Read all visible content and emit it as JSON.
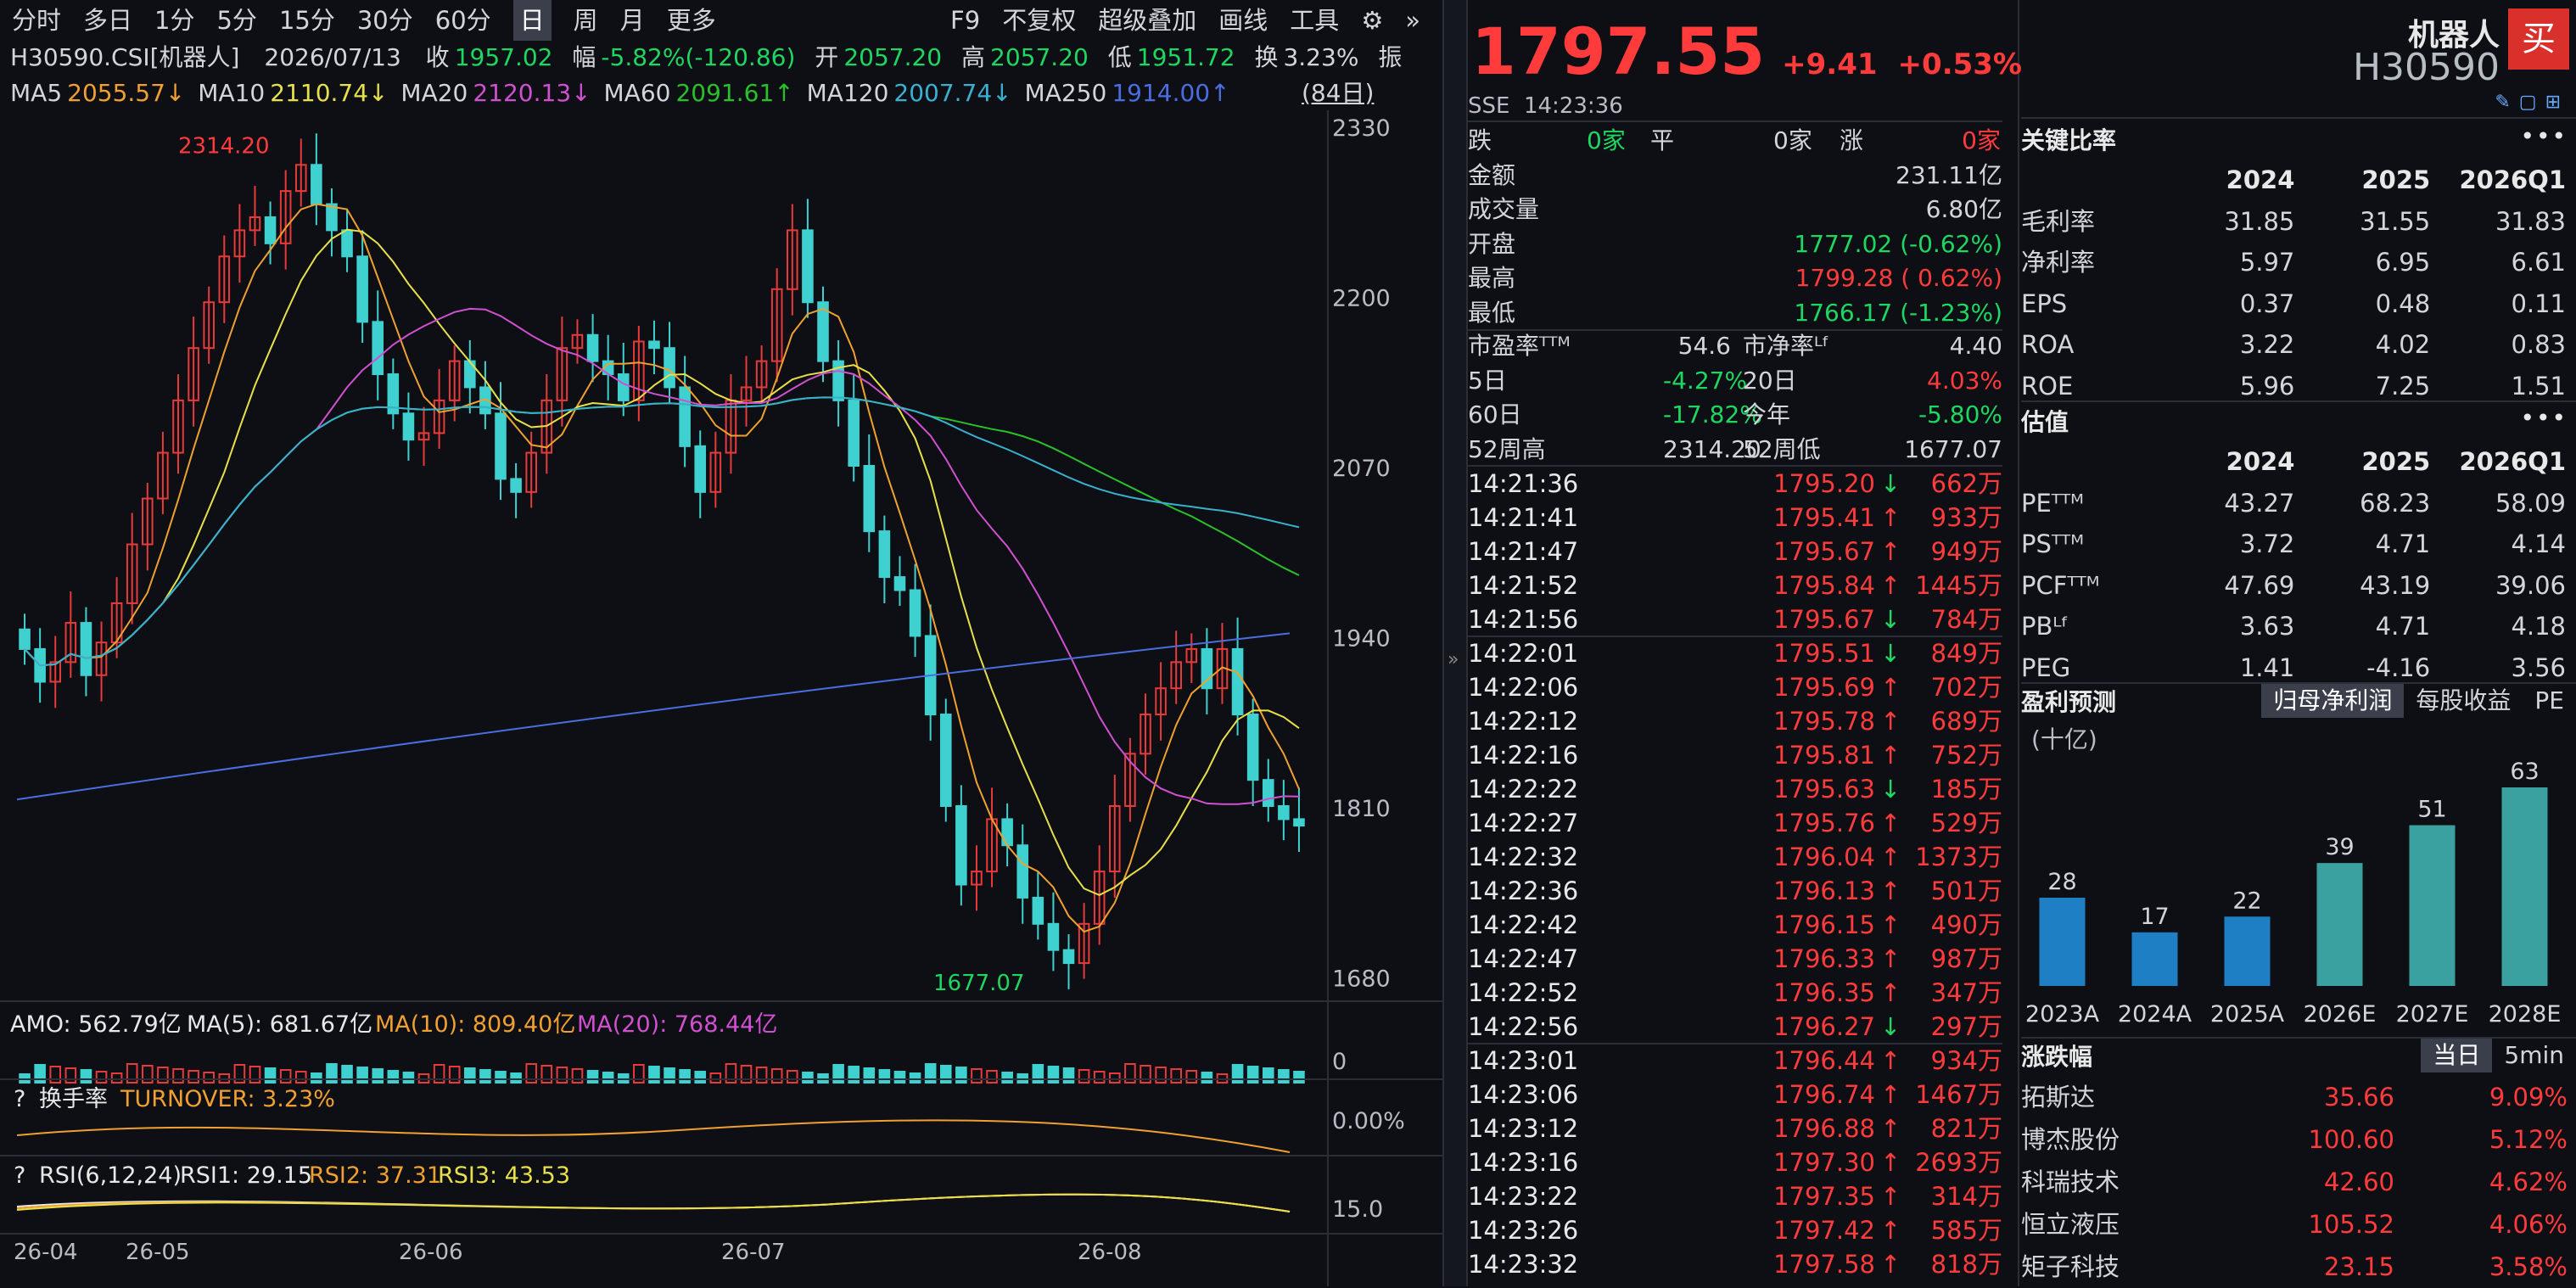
{
  "toolbar": {
    "periods": [
      "分时",
      "多日",
      "1分",
      "5分",
      "15分",
      "30分",
      "60分",
      "日",
      "周",
      "月",
      "更多"
    ],
    "active_period": "日",
    "right": [
      "F9",
      "不复权",
      "超级叠加",
      "画线",
      "工具"
    ]
  },
  "info": {
    "code": "H30590.CSI[机器人]",
    "date": "2026/07/13",
    "close_label": "收",
    "close": "1957.02",
    "chg_label": "幅",
    "chg": "-5.82%(-120.86)",
    "open_label": "开",
    "open": "2057.20",
    "high_label": "高",
    "high": "2057.20",
    "low_label": "低",
    "low": "1951.72",
    "turnover_label": "换",
    "turnover": "3.23%",
    "amp_label": "振"
  },
  "ma": {
    "ma5": "MA5",
    "ma5_val": "2055.57↓",
    "ma10": "MA10",
    "ma10_val": "2110.74↓",
    "ma20": "MA20",
    "ma20_val": "2120.13↓",
    "ma60": "MA60",
    "ma60_val": "2091.61↑",
    "ma120": "MA120",
    "ma120_val": "2007.74↓",
    "ma250": "MA250",
    "ma250_val": "1914.00↑",
    "days": "(84日)"
  },
  "chart_data": {
    "type": "candlestick",
    "y_axis_ticks": [
      "2330",
      "2200",
      "2070",
      "1940",
      "1810",
      "1680"
    ],
    "x_axis_ticks": [
      "26-04",
      "26-05",
      "26-06",
      "26-07",
      "26-08"
    ],
    "annotations": {
      "high": "2314.20",
      "low": "1677.07"
    },
    "volume": {
      "label": "AMO: 562.79亿",
      "ma5": "MA(5): 681.67亿",
      "ma10": "MA(10): 809.40亿",
      "ma20": "MA(20): 768.44亿",
      "axis": "0"
    },
    "turnover": {
      "q": "?",
      "label": "换手率",
      "value": "TURNOVER: 3.23%",
      "axis": "0.00%"
    },
    "rsi": {
      "q": "?",
      "label": "RSI(6,12,24)",
      "rsi1": "RSI1: 29.15",
      "rsi2": "RSI2: 37.31",
      "rsi3": "RSI3: 43.53",
      "axis": "15.0"
    }
  },
  "quote": {
    "price": "1797.55",
    "change": "+9.41",
    "change_pct": "+0.53%",
    "exchange": "SSE",
    "time": "14:23:36",
    "breadth": {
      "down_label": "跌",
      "down": "0家",
      "flat_label": "平",
      "flat": "0家",
      "up_label": "涨",
      "up": "0家"
    },
    "amount_label": "金额",
    "amount": "231.11亿",
    "volume_label": "成交量",
    "volume": "6.80亿",
    "open_label": "开盘",
    "open": "1777.02 (-0.62%)",
    "high_label": "最高",
    "high": "1799.28 ( 0.62%)",
    "low_label": "最低",
    "low": "1766.17 (-1.23%)",
    "pe_label": "市盈率ᵀᵀᴹ",
    "pe": "54.6",
    "pb_label": "市净率ᴸᶠ",
    "pb": "4.40",
    "d5_label": "5日",
    "d5": "-4.27%",
    "d20_label": "20日",
    "d20": "4.03%",
    "d60_label": "60日",
    "d60": "-17.82%",
    "ytd_label": "今年",
    "ytd": "-5.80%",
    "w52h_label": "52周高",
    "w52h": "2314.20",
    "w52l_label": "52周低",
    "w52l": "1677.07"
  },
  "ticks": [
    {
      "t": "14:21:36",
      "p": "1795.20",
      "d": "down",
      "v": "662万"
    },
    {
      "t": "14:21:41",
      "p": "1795.41",
      "d": "up",
      "v": "933万"
    },
    {
      "t": "14:21:47",
      "p": "1795.67",
      "d": "up",
      "v": "949万"
    },
    {
      "t": "14:21:52",
      "p": "1795.84",
      "d": "up",
      "v": "1445万"
    },
    {
      "t": "14:21:56",
      "p": "1795.67",
      "d": "down",
      "v": "784万"
    },
    {
      "t": "14:22:01",
      "p": "1795.51",
      "d": "down",
      "v": "849万"
    },
    {
      "t": "14:22:06",
      "p": "1795.69",
      "d": "up",
      "v": "702万"
    },
    {
      "t": "14:22:12",
      "p": "1795.78",
      "d": "up",
      "v": "689万"
    },
    {
      "t": "14:22:16",
      "p": "1795.81",
      "d": "up",
      "v": "752万"
    },
    {
      "t": "14:22:22",
      "p": "1795.63",
      "d": "down",
      "v": "185万"
    },
    {
      "t": "14:22:27",
      "p": "1795.76",
      "d": "up",
      "v": "529万"
    },
    {
      "t": "14:22:32",
      "p": "1796.04",
      "d": "up",
      "v": "1373万"
    },
    {
      "t": "14:22:36",
      "p": "1796.13",
      "d": "up",
      "v": "501万"
    },
    {
      "t": "14:22:42",
      "p": "1796.15",
      "d": "up",
      "v": "490万"
    },
    {
      "t": "14:22:47",
      "p": "1796.33",
      "d": "up",
      "v": "987万"
    },
    {
      "t": "14:22:52",
      "p": "1796.35",
      "d": "up",
      "v": "347万"
    },
    {
      "t": "14:22:56",
      "p": "1796.27",
      "d": "down",
      "v": "297万"
    },
    {
      "t": "14:23:01",
      "p": "1796.44",
      "d": "up",
      "v": "934万"
    },
    {
      "t": "14:23:06",
      "p": "1796.74",
      "d": "up",
      "v": "1467万"
    },
    {
      "t": "14:23:12",
      "p": "1796.88",
      "d": "up",
      "v": "821万"
    },
    {
      "t": "14:23:16",
      "p": "1797.30",
      "d": "up",
      "v": "2693万"
    },
    {
      "t": "14:23:22",
      "p": "1797.35",
      "d": "up",
      "v": "314万"
    },
    {
      "t": "14:23:26",
      "p": "1797.42",
      "d": "up",
      "v": "585万"
    },
    {
      "t": "14:23:32",
      "p": "1797.58",
      "d": "up",
      "v": "818万"
    }
  ],
  "right": {
    "name": "机器人",
    "code": "H30590",
    "buy": "买",
    "ratios": {
      "title": "关键比率",
      "cols": [
        "",
        "2024",
        "2025",
        "2026Q1"
      ],
      "rows": [
        [
          "毛利率",
          "31.85",
          "31.55",
          "31.83"
        ],
        [
          "净利率",
          "5.97",
          "6.95",
          "6.61"
        ],
        [
          "EPS",
          "0.37",
          "0.48",
          "0.11"
        ],
        [
          "ROA",
          "3.22",
          "4.02",
          "0.83"
        ],
        [
          "ROE",
          "5.96",
          "7.25",
          "1.51"
        ]
      ]
    },
    "valuation": {
      "title": "估值",
      "cols": [
        "",
        "2024",
        "2025",
        "2026Q1"
      ],
      "rows": [
        [
          "PEᵀᵀᴹ",
          "43.27",
          "68.23",
          "58.09"
        ],
        [
          "PSᵀᵀᴹ",
          "3.72",
          "4.71",
          "4.14"
        ],
        [
          "PCFᵀᵀᴹ",
          "47.69",
          "43.19",
          "39.06"
        ],
        [
          "PBᴸᶠ",
          "3.63",
          "4.71",
          "4.18"
        ],
        [
          "PEG",
          "1.41",
          "-4.16",
          "3.56"
        ]
      ]
    },
    "forecast": {
      "title": "盈利预测",
      "tabs": [
        "归母净利润",
        "每股收益",
        "PE"
      ],
      "unit": "(十亿)",
      "bars": [
        {
          "label": "2023A",
          "value": 28
        },
        {
          "label": "2024A",
          "value": 17
        },
        {
          "label": "2025A",
          "value": 22
        },
        {
          "label": "2026E",
          "value": 39
        },
        {
          "label": "2027E",
          "value": 51
        },
        {
          "label": "2028E",
          "value": 63
        }
      ],
      "color_actual": "#1e7fc4",
      "color_est": "#3aa0a0"
    },
    "movers": {
      "title": "涨跌幅",
      "tabs": [
        "当日",
        "5min"
      ],
      "rows": [
        [
          "拓斯达",
          "35.66",
          "9.09%"
        ],
        [
          "博杰股份",
          "100.60",
          "5.12%"
        ],
        [
          "科瑞技术",
          "42.60",
          "4.62%"
        ],
        [
          "恒立液压",
          "105.52",
          "4.06%"
        ],
        [
          "矩子科技",
          "23.15",
          "3.58%"
        ]
      ]
    }
  }
}
